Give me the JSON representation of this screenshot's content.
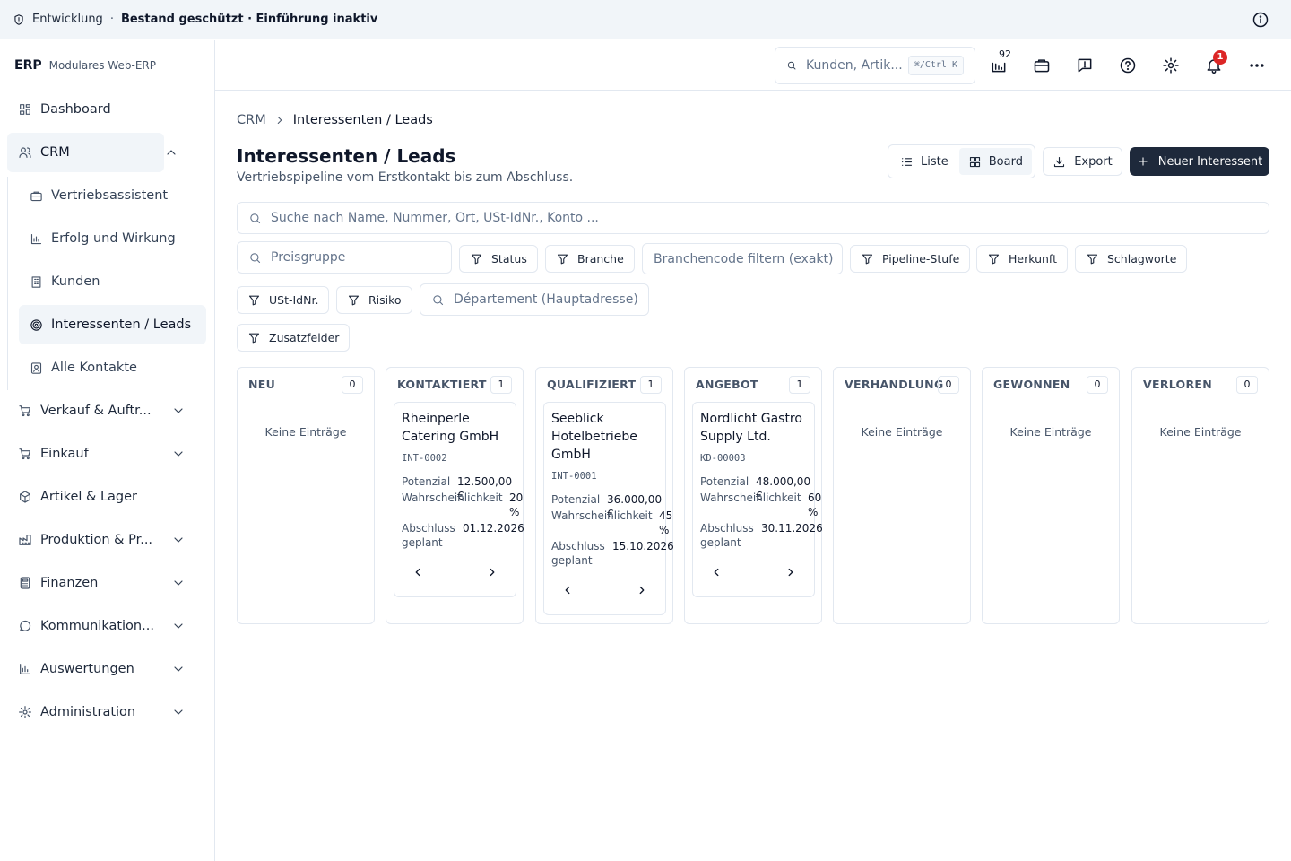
{
  "env": {
    "name": "Entwicklung",
    "separator": "·",
    "status": "Bestand geschützt · Einführung inaktiv"
  },
  "brand": {
    "logo": "ERP",
    "tagline": "Modulares Web-ERP"
  },
  "sidebar": {
    "items": [
      {
        "label": "Dashboard",
        "icon": "dashboard-icon"
      },
      {
        "label": "CRM",
        "icon": "users-icon",
        "expanded": true
      },
      {
        "label": "Verkauf & Auftr...",
        "icon": "cart-icon"
      },
      {
        "label": "Einkauf",
        "icon": "cart-icon"
      },
      {
        "label": "Artikel & Lager",
        "icon": "package-icon"
      },
      {
        "label": "Produktion & Pr...",
        "icon": "factory-icon"
      },
      {
        "label": "Finanzen",
        "icon": "calculator-icon"
      },
      {
        "label": "Kommunikation...",
        "icon": "message-icon"
      },
      {
        "label": "Auswertungen",
        "icon": "bar-chart-icon"
      },
      {
        "label": "Administration",
        "icon": "gear-icon"
      }
    ],
    "crm_sub": [
      {
        "label": "Vertriebsassistent",
        "icon": "briefcase-icon"
      },
      {
        "label": "Erfolg und Wirkung",
        "icon": "bar-chart-icon"
      },
      {
        "label": "Kunden",
        "icon": "building-icon"
      },
      {
        "label": "Interessenten / Leads",
        "icon": "target-icon",
        "active": true
      },
      {
        "label": "Alle Kontakte",
        "icon": "contact-icon"
      }
    ]
  },
  "topbar": {
    "search_placeholder": "Kunden, Artik...",
    "search_shortcut": "⌘/Ctrl K",
    "inbox_count": "92",
    "notification_count": "1"
  },
  "breadcrumb": {
    "parent": "CRM",
    "current": "Interessenten / Leads"
  },
  "page": {
    "title": "Interessenten / Leads",
    "subtitle": "Vertriebspipeline vom Erstkontakt bis zum Abschluss."
  },
  "actions": {
    "list_label": "Liste",
    "board_label": "Board",
    "export_label": "Export",
    "new_label": "Neuer Interessent"
  },
  "search": {
    "placeholder": "Suche nach Name, Nummer, Ort, USt-IdNr., Konto ..."
  },
  "filters": {
    "price_group_placeholder": "Preisgruppe",
    "status": "Status",
    "branche": "Branche",
    "branchencode_placeholder": "Branchencode filtern (exakt)",
    "pipeline": "Pipeline-Stufe",
    "herkunft": "Herkunft",
    "schlagworte": "Schlagworte",
    "ustid": "USt-IdNr.",
    "risiko": "Risiko",
    "departement_placeholder": "Département (Hauptadresse)",
    "zusatzfelder": "Zusatzfelder"
  },
  "board": {
    "empty_label": "Keine Einträge",
    "labels": {
      "potential": "Potenzial",
      "probability": "Wahrscheinlichkeit",
      "close": "Abschluss geplant"
    },
    "columns": [
      {
        "title": "NEU",
        "count": "0"
      },
      {
        "title": "KONTAKTIERT",
        "count": "1"
      },
      {
        "title": "QUALIFIZIERT",
        "count": "1"
      },
      {
        "title": "ANGEBOT",
        "count": "1"
      },
      {
        "title": "VERHANDLUNG",
        "count": "0"
      },
      {
        "title": "GEWONNEN",
        "count": "0"
      },
      {
        "title": "VERLOREN",
        "count": "0"
      }
    ],
    "cards": [
      {
        "title": "Rheinperle Catering GmbH",
        "code": "INT-0002",
        "potential": "12.500,00 €",
        "probability": "20 %",
        "close": "01.12.2026"
      },
      {
        "title": "Seeblick Hotelbetriebe GmbH",
        "code": "INT-0001",
        "potential": "36.000,00 €",
        "probability": "45 %",
        "close": "15.10.2026"
      },
      {
        "title": "Nordlicht Gastro Supply Ltd.",
        "code": "KD-00003",
        "potential": "48.000,00 €",
        "probability": "60 %",
        "close": "30.11.2026"
      }
    ]
  }
}
